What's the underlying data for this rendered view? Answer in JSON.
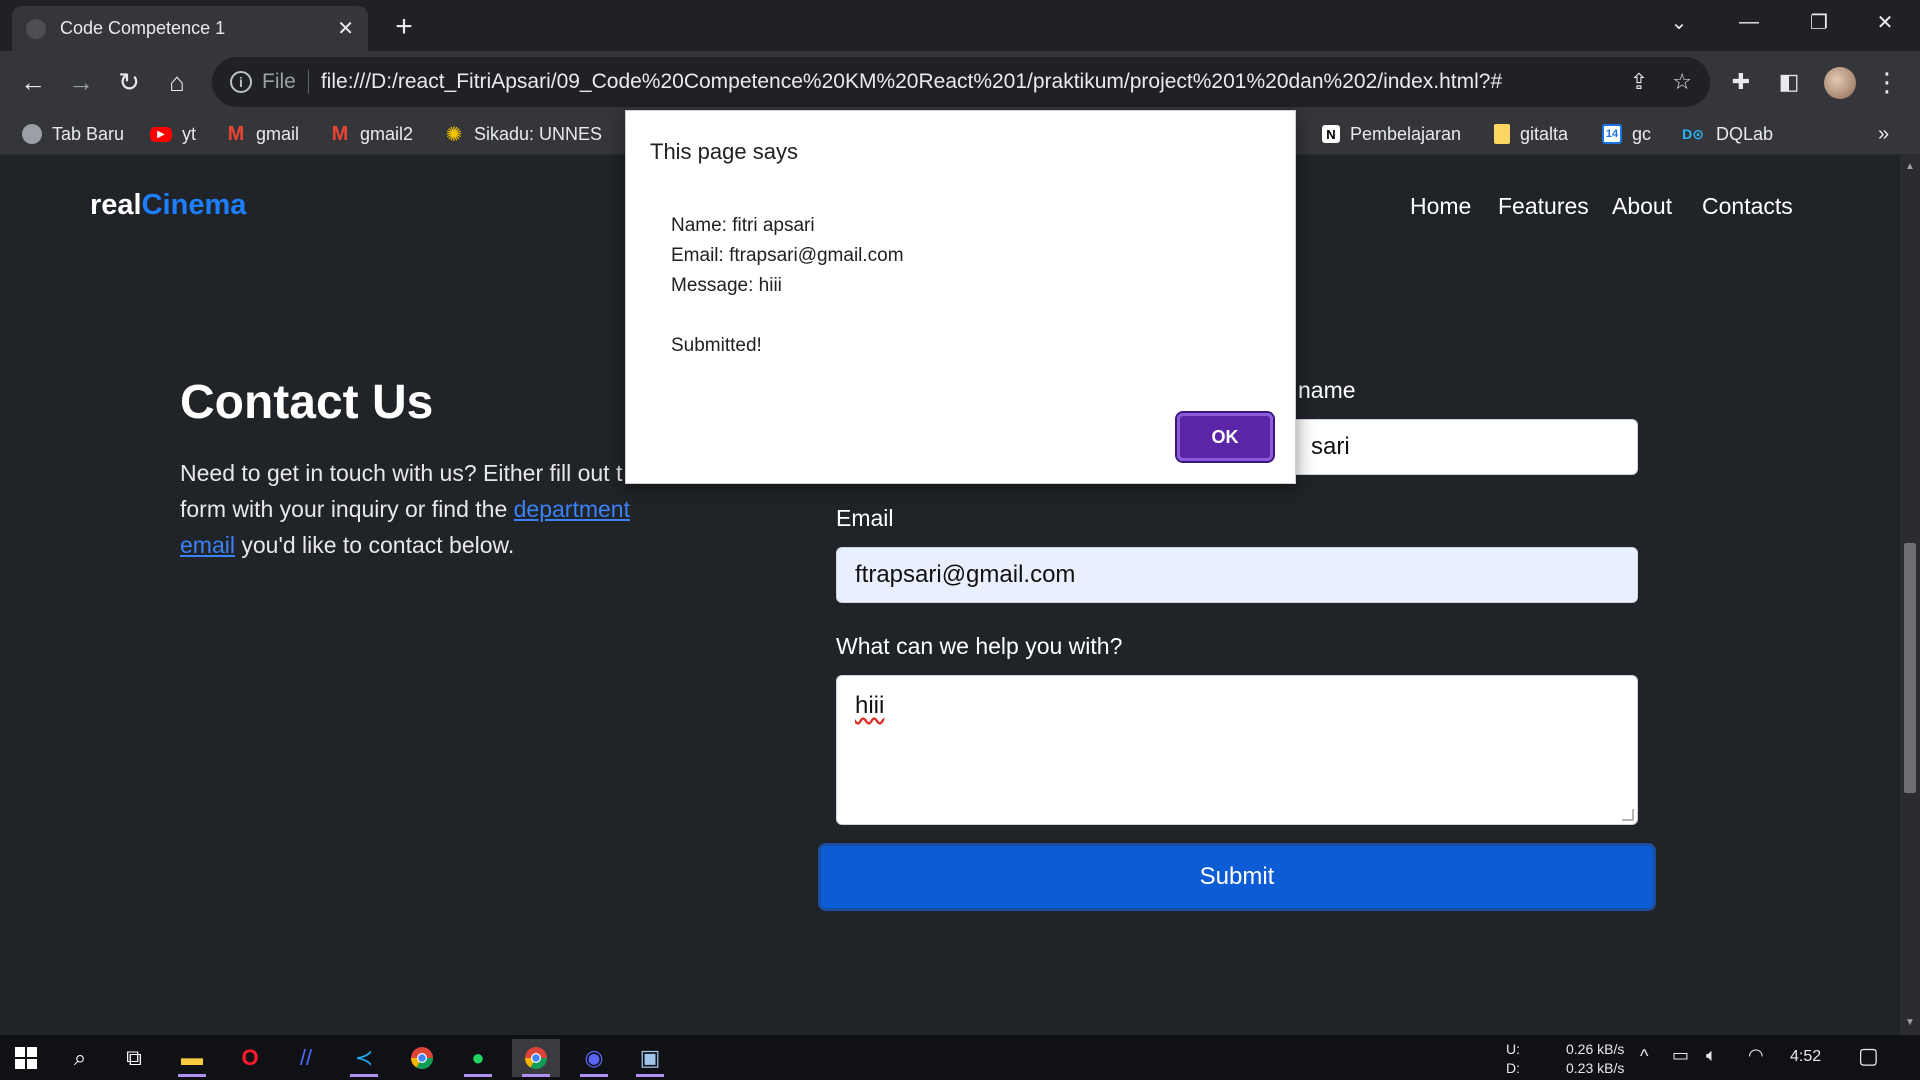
{
  "browser": {
    "tab_title": "Code Competence 1",
    "scheme_label": "File",
    "url": "file:///D:/react_FitriApsari/09_Code%20Competence%20KM%20React%201/praktikum/project%201%20dan%202/index.html?#",
    "bookmarks": [
      {
        "label": "Tab Baru",
        "icon": "globe-icon"
      },
      {
        "label": "yt",
        "icon": "youtube-icon"
      },
      {
        "label": "gmail",
        "icon": "gmail-icon"
      },
      {
        "label": "gmail2",
        "icon": "gmail-icon"
      },
      {
        "label": "Sikadu: UNNES",
        "icon": "unnes-icon"
      },
      {
        "label": "Pembelajaran",
        "icon": "notion-icon"
      },
      {
        "label": "gitalta",
        "icon": "folder-icon"
      },
      {
        "label": "gc",
        "icon": "calendar-icon"
      },
      {
        "label": "DQLab",
        "icon": "dqlab-icon"
      }
    ],
    "more_bookmarks": "»"
  },
  "page": {
    "brand_primary": "real",
    "brand_accent": "Cinema",
    "nav": [
      "Home",
      "Features",
      "About",
      "Contacts"
    ],
    "contact_title": "Contact Us",
    "contact_desc_before": "Need to get in touch with us? Either fill out t",
    "contact_desc_line2": "form with your inquiry or find the ",
    "contact_link_1": "department",
    "contact_link_2": "email",
    "contact_desc_after": " you'd like to contact below.",
    "name_label_visible": "name",
    "name_value_visible": "sari",
    "email_label": "Email",
    "email_value": "ftrapsari@gmail.com",
    "message_label": "What can we help you with?",
    "message_value": "hiii",
    "submit_label": "Submit"
  },
  "dialog": {
    "title": "This page says",
    "line_name": "Name: fitri apsari",
    "line_email": "Email: ftrapsari@gmail.com",
    "line_message": "Message: hiii",
    "line_status": "Submitted!",
    "ok_label": "OK"
  },
  "taskbar": {
    "upload_label": "U:",
    "download_label": "D:",
    "upload_speed": "0.26 kB/s",
    "download_speed": "0.23 kB/s",
    "clock": "4:52"
  },
  "colors": {
    "brand_accent": "#1b7fff",
    "submit": "#0b5cd5",
    "ok_button": "#5b25a8",
    "page_bg": "#202328"
  }
}
